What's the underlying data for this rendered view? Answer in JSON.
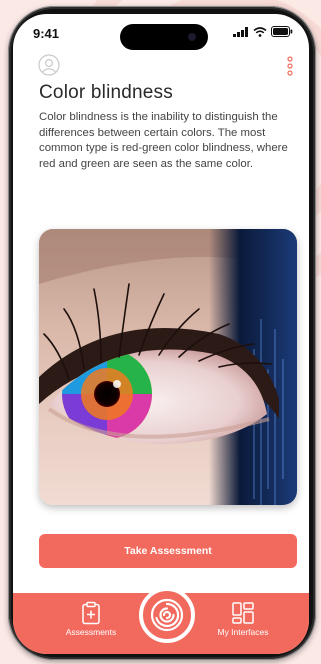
{
  "status_bar": {
    "time": "9:41"
  },
  "header": {
    "avatar_icon": "user-circle-icon",
    "menu_icon": "kebab-menu-icon"
  },
  "content": {
    "title": "Color blindness",
    "description": "Color blindness is the inability to distinguish the differences between certain colors. The most common type is red-green color blindness, where red and green are seen as the same color.",
    "hero_image": "close-up-rainbow-eye-photo"
  },
  "cta": {
    "label": "Take Assessment"
  },
  "bottom_nav": {
    "items": [
      {
        "label": "Assessments",
        "icon": "clipboard-plus-icon"
      },
      {
        "label": "My Interfaces",
        "icon": "grid-layout-icon"
      }
    ],
    "center_icon": "swirl-logo-icon"
  },
  "colors": {
    "accent": "#f26a5e",
    "background": "#fbe9e6",
    "text_dark": "#2a2a2a",
    "text_body": "#444444"
  }
}
